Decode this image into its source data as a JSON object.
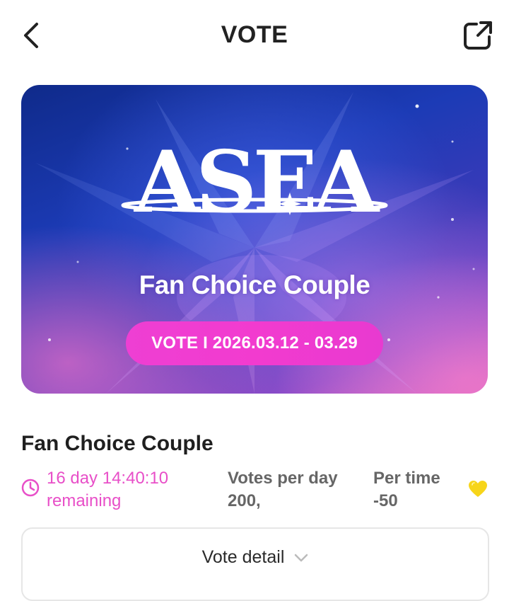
{
  "header": {
    "title": "VOTE",
    "back_icon": "chevron-left-icon",
    "share_icon": "share-external-icon"
  },
  "banner": {
    "logo_text": "ASEA",
    "subtitle": "Fan Choice Couple",
    "vote_period": "VOTE I 2026.03.12 - 03.29",
    "pill_color": "#f03dd0",
    "background_colors": [
      "#0f2a8a",
      "#1c3bb6",
      "#8a4bc8",
      "#d46bc9"
    ]
  },
  "vote": {
    "title": "Fan Choice Couple",
    "remaining_line1": "16 day 14:40:10",
    "remaining_line2": "remaining",
    "votes_per_day_label": "Votes per day",
    "votes_per_day_value": "200,",
    "per_time_label": "Per time",
    "per_time_value": "-50",
    "accent_color": "#e84fc8",
    "heart_color": "#f7d51a"
  },
  "detail": {
    "label": "Vote detail",
    "icon": "chevron-down-icon"
  }
}
